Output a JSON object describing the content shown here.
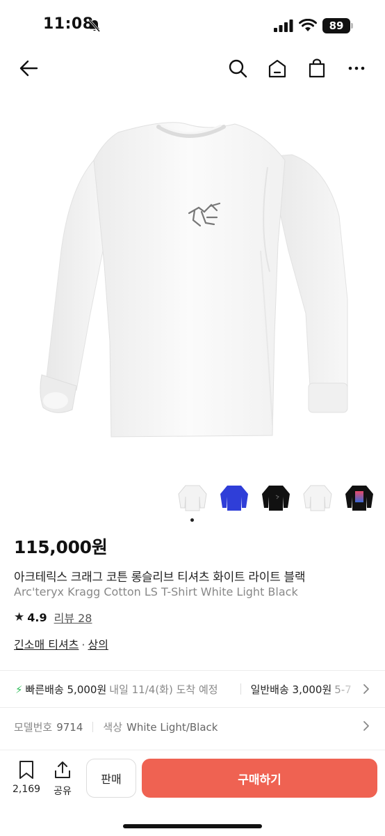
{
  "status_bar": {
    "time": "11:08",
    "battery": "89"
  },
  "nav": {
    "icons": [
      "back-arrow-icon",
      "search-icon",
      "home-icon",
      "shopping-bag-icon",
      "more-icon"
    ]
  },
  "product": {
    "price": "115,000원",
    "name_ko": "아크테릭스 크래그 코튼 롱슬리브 티셔츠 화이트 라이트 블랙",
    "name_en": "Arc'teryx Kragg Cotton LS T-Shirt White Light Black",
    "rating": "4.9",
    "reviews": "리뷰 28",
    "category1": "긴소매 티셔츠",
    "separator": "·",
    "category2": "상의"
  },
  "colors": {
    "accent": "#ef6252",
    "fast_shipping": "#2fbe5a",
    "thumb_blue": "#2f3ed8"
  },
  "shipping": {
    "fast_label": "빠른배송 5,000원",
    "fast_eta": "내일 11/4(화) 도착 예정",
    "standard_label": "일반배송 3,000원",
    "standard_eta": "5-7"
  },
  "specs": {
    "model_label": "모델번호",
    "model_value": "9714",
    "color_label": "색상",
    "color_value": "White Light/Black"
  },
  "bottom_bar": {
    "bookmark_count": "2,169",
    "share_label": "공유",
    "sell_label": "판매",
    "buy_label": "구매하기"
  }
}
